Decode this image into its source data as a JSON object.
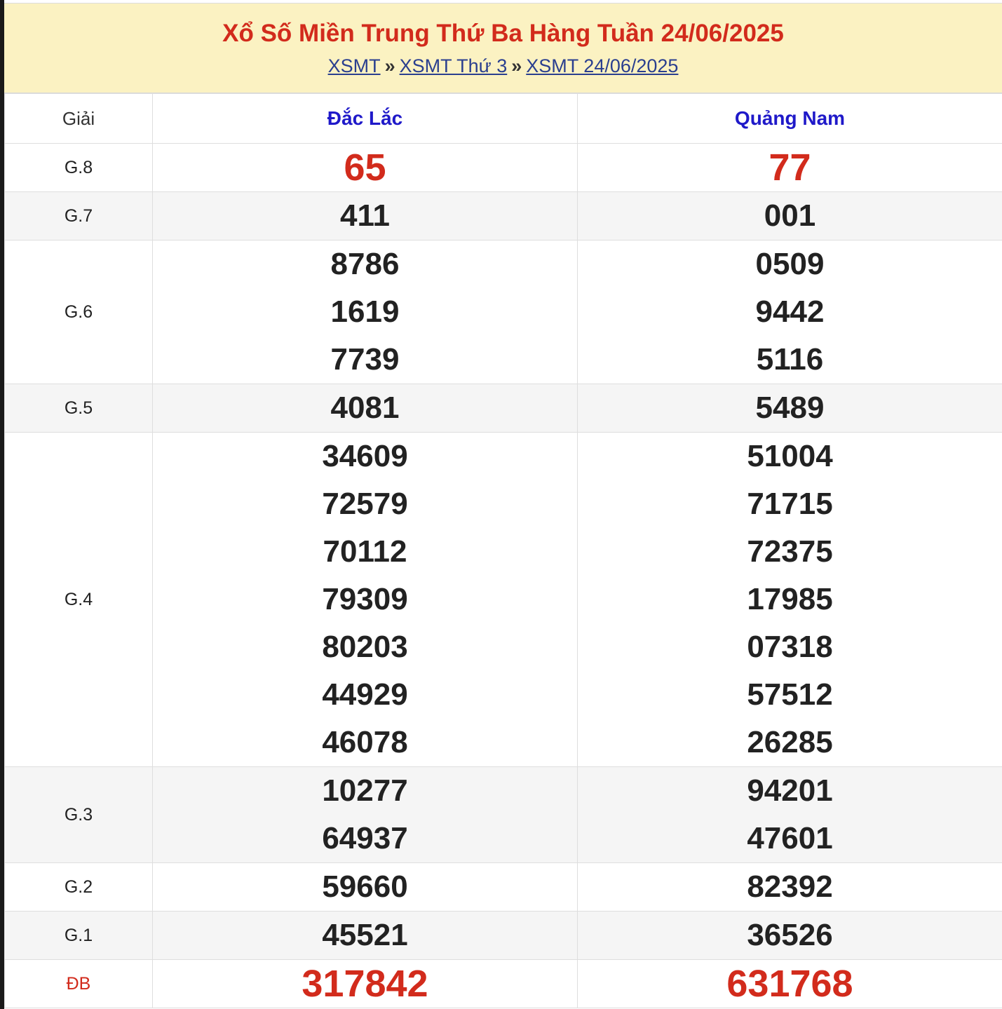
{
  "header": {
    "title": "Xổ Số Miền Trung Thứ Ba Hàng Tuần 24/06/2025",
    "crumbs": [
      "XSMT",
      "XSMT Thứ 3",
      "XSMT 24/06/2025"
    ],
    "separator": "»"
  },
  "table": {
    "label_header": "Giải",
    "provinces": [
      "Đắc Lắc",
      "Quảng Nam"
    ],
    "rows": [
      {
        "label": "G.8",
        "a": [
          "65"
        ],
        "b": [
          "77"
        ]
      },
      {
        "label": "G.7",
        "a": [
          "411"
        ],
        "b": [
          "001"
        ]
      },
      {
        "label": "G.6",
        "a": [
          "8786",
          "1619",
          "7739"
        ],
        "b": [
          "0509",
          "9442",
          "5116"
        ]
      },
      {
        "label": "G.5",
        "a": [
          "4081"
        ],
        "b": [
          "5489"
        ]
      },
      {
        "label": "G.4",
        "a": [
          "34609",
          "72579",
          "70112",
          "79309",
          "80203",
          "44929",
          "46078"
        ],
        "b": [
          "51004",
          "71715",
          "72375",
          "17985",
          "07318",
          "57512",
          "26285"
        ]
      },
      {
        "label": "G.3",
        "a": [
          "10277",
          "64937"
        ],
        "b": [
          "94201",
          "47601"
        ]
      },
      {
        "label": "G.2",
        "a": [
          "59660"
        ],
        "b": [
          "82392"
        ]
      },
      {
        "label": "G.1",
        "a": [
          "45521"
        ],
        "b": [
          "36526"
        ]
      },
      {
        "label": "ĐB",
        "a": [
          "317842"
        ],
        "b": [
          "631768"
        ]
      }
    ]
  },
  "colors": {
    "accent_red": "#d22b1c",
    "province_blue": "#1f19c9",
    "header_bg": "#fbf2c2"
  }
}
